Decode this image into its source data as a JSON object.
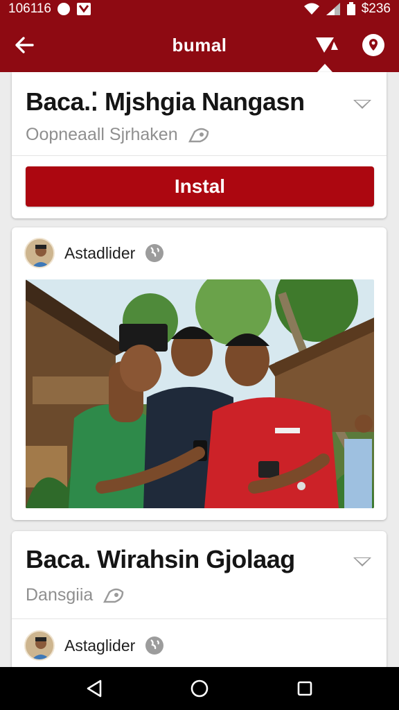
{
  "status_bar": {
    "time": "106116",
    "battery_label": "$236"
  },
  "app_bar": {
    "title": "bumal"
  },
  "card1": {
    "title": "Baca.⁚ Mjshgia Nangasn",
    "subtitle": "Oopneaall  Sjrhaken",
    "install_label": "Instal"
  },
  "card2": {
    "author": "Astadlider"
  },
  "card3": {
    "title": "Baca. Wirahsin Gjolaag",
    "subtitle": "Dansgiia",
    "author": "Astaglider"
  },
  "colors": {
    "brand": "#8e0a12",
    "button": "#ac0710"
  }
}
